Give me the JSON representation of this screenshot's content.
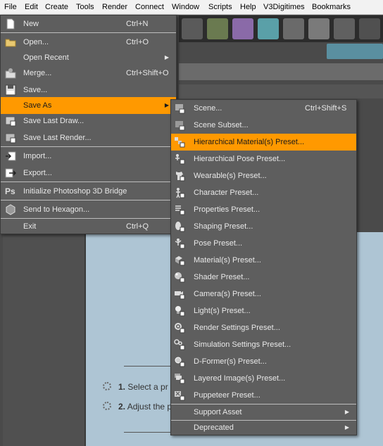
{
  "menubar": {
    "file": "File",
    "edit": "Edit",
    "create": "Create",
    "tools": "Tools",
    "render": "Render",
    "connect": "Connect",
    "window": "Window",
    "scripts": "Scripts",
    "help": "Help",
    "v3digitimes": "V3Digitimes",
    "bookmarks": "Bookmarks"
  },
  "file_menu": {
    "new": "New",
    "new_sc": "Ctrl+N",
    "open": "Open...",
    "open_sc": "Ctrl+O",
    "open_recent": "Open Recent",
    "merge": "Merge...",
    "merge_sc": "Ctrl+Shift+O",
    "save": "Save...",
    "save_as": "Save As",
    "save_last_draw": "Save Last Draw...",
    "save_last_render": "Save Last Render...",
    "import": "Import...",
    "export": "Export...",
    "ps_bridge": "Initialize Photoshop 3D Bridge",
    "hexagon": "Send to Hexagon...",
    "exit": "Exit",
    "exit_sc": "Ctrl+Q"
  },
  "save_as_menu": {
    "scene": "Scene...",
    "scene_sc": "Ctrl+Shift+S",
    "scene_subset": "Scene Subset...",
    "hier_material": "Hierarchical Material(s) Preset...",
    "hier_pose": "Hierarchical Pose Preset...",
    "wearable": "Wearable(s) Preset...",
    "character": "Character Preset...",
    "properties": "Properties Preset...",
    "shaping": "Shaping Preset...",
    "pose": "Pose Preset...",
    "material": "Material(s) Preset...",
    "shader": "Shader Preset...",
    "camera": "Camera(s) Preset...",
    "light": "Light(s) Preset...",
    "render_settings": "Render Settings Preset...",
    "simulation_settings": "Simulation Settings Preset...",
    "dformer": "D-Former(s) Preset...",
    "layered_image": "Layered Image(s) Preset...",
    "puppeteer": "Puppeteer Preset...",
    "support_asset": "Support Asset",
    "deprecated": "Deprecated"
  },
  "background": {
    "step1_num": "1.",
    "step1_text": "Select a pr",
    "step2_num": "2.",
    "step2_text": "Adjust the p"
  },
  "colors": {
    "highlight": "#ff9900",
    "menu_bg": "#5e5e5e",
    "menubar_bg": "#f2f2f2"
  }
}
